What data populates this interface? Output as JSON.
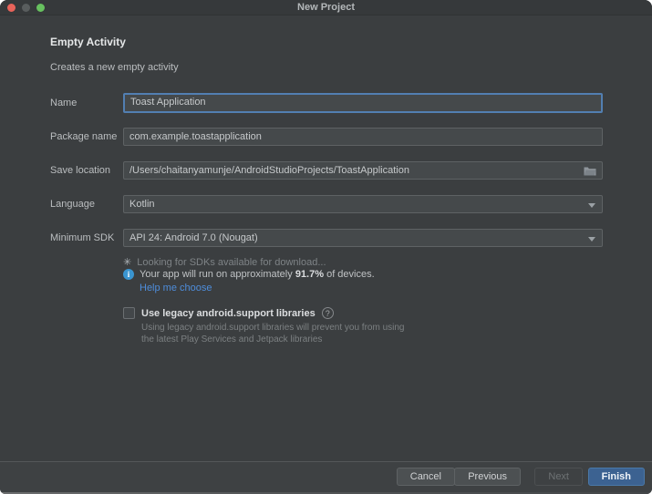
{
  "window": {
    "title": "New Project"
  },
  "header": {
    "title": "Empty Activity",
    "subtitle": "Creates a new empty activity"
  },
  "form": {
    "name": {
      "label": "Name",
      "value": "Toast Application",
      "focused": true
    },
    "package": {
      "label": "Package name",
      "value": "com.example.toastapplication"
    },
    "save_location": {
      "label": "Save location",
      "value": "/Users/chaitanyamunje/AndroidStudioProjects/ToastApplication",
      "icon": "folder-icon"
    },
    "language": {
      "label": "Language",
      "value": "Kotlin"
    },
    "min_sdk": {
      "label": "Minimum SDK",
      "value": "API 24: Android 7.0 (Nougat)"
    }
  },
  "sdk_info": {
    "loading_text": "Looking for SDKs available for download...",
    "devices_prefix": "Your app will run on approximately ",
    "devices_percent": "91.7%",
    "devices_suffix": " of devices.",
    "help_link": "Help me choose"
  },
  "legacy": {
    "checkbox_label": "Use legacy android.support libraries",
    "checked": false,
    "description_line1": "Using legacy android.support libraries will prevent you from using",
    "description_line2": "the latest Play Services and Jetpack libraries"
  },
  "footer": {
    "buttons": [
      {
        "label": "Cancel",
        "state": "enabled"
      },
      {
        "label": "Previous",
        "state": "enabled"
      },
      {
        "label": "Next",
        "state": "disabled"
      },
      {
        "label": "Finish",
        "state": "primary"
      }
    ]
  },
  "icons": {
    "spinner": "✳",
    "info": "i",
    "question": "?"
  },
  "colors": {
    "panel_bg": "#3b3e40",
    "titlebar_bg": "#36393b",
    "field_bg": "#45494b",
    "field_border": "#5e6264",
    "focus_border": "#527fb2",
    "link_blue": "#4e8ddb",
    "info_blue": "#3a95d0",
    "primary_button": "#3c6291",
    "traffic_close": "#e8635a",
    "traffic_min": "#595d5e",
    "traffic_zoom": "#67c15f"
  }
}
